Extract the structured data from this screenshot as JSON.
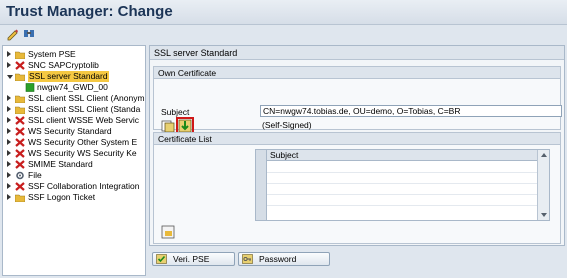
{
  "window": {
    "title": "Trust Manager: Change"
  },
  "toolbar": {
    "icons": [
      "change-display-icon",
      "glasses-icon"
    ]
  },
  "tree": {
    "items": [
      {
        "label": "System PSE",
        "icon": "folder-icon",
        "expanded": false
      },
      {
        "label": "SNC SAPCryptolib",
        "icon": "red-x-icon",
        "expanded": false
      },
      {
        "label": "SSL server Standard",
        "icon": "folder-icon",
        "expanded": true,
        "selected": true
      },
      {
        "label": "nwgw74_GWD_00",
        "icon": "green-status-icon",
        "child": true
      },
      {
        "label": "SSL client SSL Client (Anonym",
        "icon": "folder-icon",
        "expanded": false
      },
      {
        "label": "SSL client SSL Client (Standa",
        "icon": "folder-icon",
        "expanded": false
      },
      {
        "label": "SSL client WSSE Web Servic",
        "icon": "red-x-icon",
        "expanded": false
      },
      {
        "label": "WS Security Standard",
        "icon": "red-x-icon",
        "expanded": false
      },
      {
        "label": "WS Security Other System E",
        "icon": "red-x-icon",
        "expanded": false
      },
      {
        "label": "WS Security WS Security Ke",
        "icon": "red-x-icon",
        "expanded": false
      },
      {
        "label": "SMIME Standard",
        "icon": "red-x-icon",
        "expanded": false
      },
      {
        "label": "File",
        "icon": "gear-icon",
        "expanded": false
      },
      {
        "label": "SSF Collaboration Integration",
        "icon": "red-x-icon",
        "expanded": false
      },
      {
        "label": "SSF Logon Ticket",
        "icon": "folder-icon",
        "expanded": false
      }
    ]
  },
  "main": {
    "panel_title": "SSL server Standard",
    "own_certificate": {
      "title": "Own Certificate",
      "subject_label": "Subject",
      "subject_value": "CN=nwgw74.tobias.de, OU=demo, O=Tobias, C=BR",
      "self_signed": "(Self-Signed)"
    },
    "certificate_list": {
      "title": "Certificate List",
      "column": "Subject"
    }
  },
  "buttons": {
    "veri_pse": "Veri. PSE",
    "password": "Password"
  },
  "colors": {
    "selected": "#f5c842",
    "red_x": "#c81e1e",
    "title": "#1c3557"
  }
}
